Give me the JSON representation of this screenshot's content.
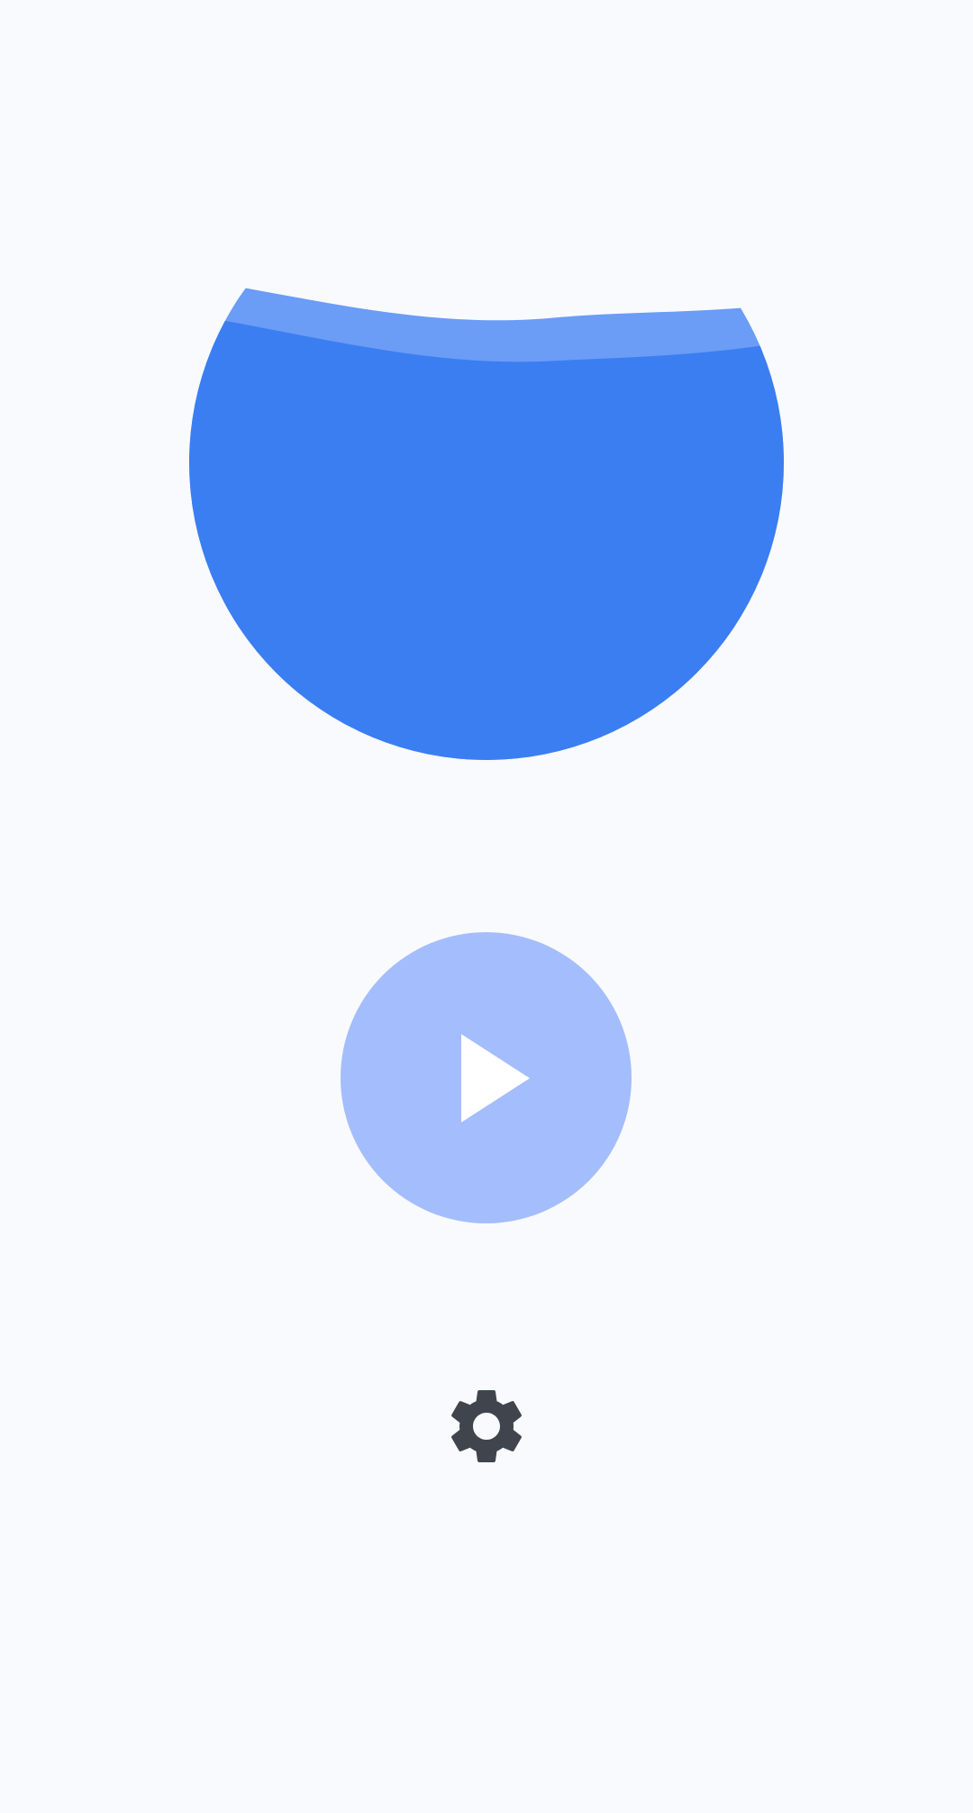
{
  "colors": {
    "background": "#F8FAFD",
    "water": "#3B7EF2",
    "water_wave": "#6B9CF6",
    "play_button": "#A4BDFC",
    "play_icon": "#FFFFFF",
    "settings_icon": "#40444D"
  },
  "water_level": {
    "fill_fraction": 0.82
  },
  "icons": {
    "play": "play-icon",
    "settings": "gear-icon"
  }
}
